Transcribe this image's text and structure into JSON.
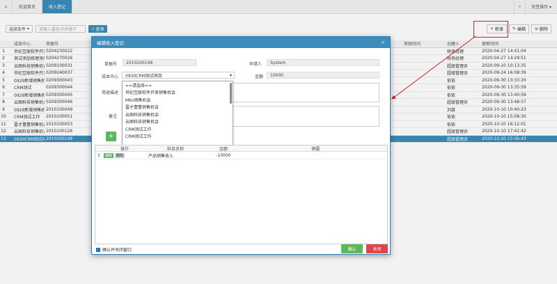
{
  "topbar": {
    "left_nav_icon": "«",
    "tabs": [
      {
        "label": "欢迎首页",
        "active": false
      },
      {
        "label": "收入登记",
        "active": true
      }
    ],
    "right_nav_icon": "»",
    "page_ops_label": "页签操作 ▾"
  },
  "search": {
    "condition_label": "选择条件",
    "input_placeholder": "请输入要查询关键字",
    "query_label": "查询"
  },
  "toolbar": {
    "add_label": "新增",
    "edit_label": "编辑",
    "delete_label": "删除"
  },
  "grid": {
    "headers": {
      "center": "成本中心",
      "bill": "单据号",
      "time1": "审核时间",
      "creator": "创建人",
      "update": "更新时间"
    },
    "rows": [
      {
        "num": "1",
        "center": "世纪互联软件开发销售机会",
        "bill": "0204230022",
        "creator": "财务经理",
        "update": "2020-04-27 14:41:04",
        "selected": false
      },
      {
        "num": "2",
        "center": "测试添加修理添加修理",
        "bill": "0204270026",
        "creator": "财务经理",
        "update": "2020-04-27 14:29:51",
        "selected": false
      },
      {
        "num": "3",
        "center": "云图科技销售机会",
        "bill": "0209100031",
        "creator": "超级管理员",
        "update": "2020-09-10 10:13:35",
        "selected": false
      },
      {
        "num": "4",
        "center": "世纪互联软件开发销售机会",
        "bill": "0209240037",
        "creator": "超级管理员",
        "update": "2020-09-24 16:08:39",
        "selected": false
      },
      {
        "num": "5",
        "center": "0929新增销售机会测试",
        "bill": "0209300043",
        "creator": "依依",
        "update": "2020-09-30 13:33:20",
        "selected": false
      },
      {
        "num": "6",
        "center": "CRM测试",
        "bill": "0209300044",
        "creator": "依依",
        "update": "2020-09-30 13:35:59",
        "selected": false
      },
      {
        "num": "7",
        "center": "0929新增销售机会测试",
        "bill": "0209300045",
        "creator": "依依",
        "update": "2020-09-30 13:40:59",
        "selected": false
      },
      {
        "num": "8",
        "center": "云图科技销售机会",
        "bill": "0209300046",
        "creator": "超级管理员",
        "update": "2020-09-30 13:48:57",
        "selected": false
      },
      {
        "num": "9",
        "center": "0929新增销售机会测试",
        "bill": "2010100049",
        "creator": "刘莱",
        "update": "2020-10-10 10:40:23",
        "selected": false
      },
      {
        "num": "10",
        "center": "CRM测试工作",
        "bill": "2010100051",
        "creator": "依依",
        "update": "2020-10-10 15:08:30",
        "selected": false
      },
      {
        "num": "11",
        "center": "雷才蕾蕾销售机会",
        "bill": "2010100053",
        "creator": "依依",
        "update": "2020-10-10 16:12:01",
        "selected": false
      },
      {
        "num": "12",
        "center": "云图科技销售机会",
        "bill": "2010100126",
        "creator": "超级管理员",
        "update": "2020-10-10 17:42:42",
        "selected": false
      },
      {
        "num": "13",
        "center": "0930CRM测试项目",
        "bill": "2010200148",
        "creator": "超级管理员",
        "update": "2020-10-20 15:06:43",
        "selected": true
      }
    ]
  },
  "modal": {
    "title": "编辑收入登记",
    "close_icon": "×",
    "bill_label": "单据号",
    "bill_value": "2010200148",
    "applicant_label": "申请人",
    "applicant_value": "System",
    "center_label": "成本中心",
    "center_value": "0930CRM测试项目",
    "amount_label": "金额",
    "amount_value": "10000",
    "desc_label": "用途描述",
    "note_label": "备注",
    "dropdown_options": [
      "==请选择==",
      "世纪互联软件开发销售机会",
      "M6x销售机会",
      "雷才蕾蕾销售机会",
      "云图科技销售机会",
      "云图科技销售机会",
      "CRM测试工作",
      "CRM测试工作"
    ],
    "subgrid": {
      "headers": {
        "op": "操作",
        "subject": "科目名称",
        "amount": "金额",
        "note": "摘要"
      },
      "rows": [
        {
          "num": "1",
          "edit": "编辑",
          "del": "删除",
          "subject": "产品销售收入",
          "amount": "-10000",
          "note": ""
        }
      ]
    },
    "confirm_close_label": "确认并关闭窗口",
    "ok_label": "确认",
    "close_label": "关闭"
  }
}
